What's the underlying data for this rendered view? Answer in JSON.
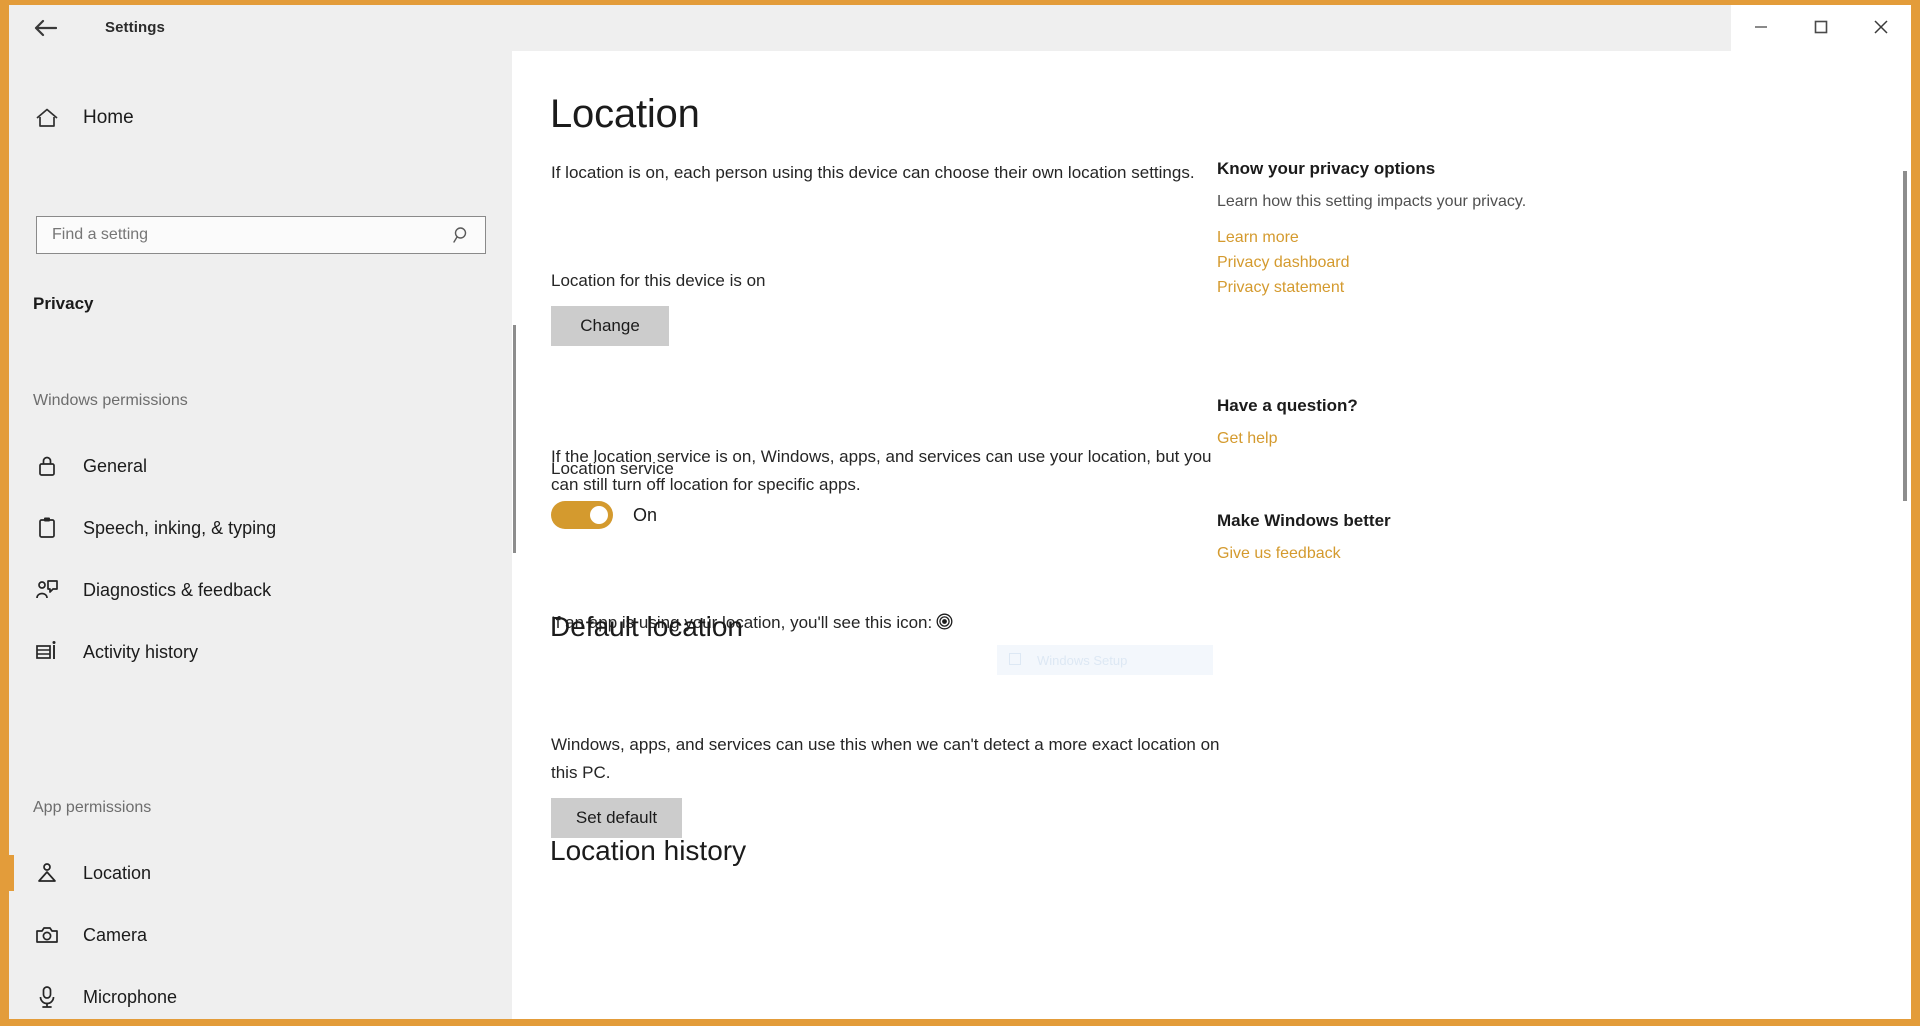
{
  "window": {
    "title": "Settings",
    "back_icon": "back-arrow-icon",
    "controls": {
      "minimize": "minimize-icon",
      "maximize": "maximize-icon",
      "close": "close-icon"
    }
  },
  "sidebar": {
    "home": {
      "label": "Home",
      "icon": "home-icon"
    },
    "search": {
      "placeholder": "Find a setting",
      "value": "",
      "icon": "search-icon"
    },
    "current_section": "Privacy",
    "groups": [
      {
        "header": "Windows permissions",
        "items": [
          {
            "label": "General",
            "icon": "lock-icon",
            "selected": false
          },
          {
            "label": "Speech, inking, & typing",
            "icon": "clipboard-icon",
            "selected": false
          },
          {
            "label": "Diagnostics & feedback",
            "icon": "feedback-person-icon",
            "selected": false
          },
          {
            "label": "Activity history",
            "icon": "activity-history-icon",
            "selected": false
          }
        ]
      },
      {
        "header": "App permissions",
        "items": [
          {
            "label": "Location",
            "icon": "location-pin-person-icon",
            "selected": true
          },
          {
            "label": "Camera",
            "icon": "camera-icon",
            "selected": false
          },
          {
            "label": "Microphone",
            "icon": "microphone-icon",
            "selected": false
          }
        ]
      }
    ]
  },
  "main": {
    "page_title": "Location",
    "intro_text": "If location is on, each person using this device can choose their own location settings.",
    "device_state_text": "Location for this device is on",
    "change_button": "Change",
    "service_description": "If the location service is on, Windows, apps, and services can use your location, but you can still turn off location for specific apps.",
    "location_service_label": "Location service",
    "location_service_state": "On",
    "location_service_on": true,
    "icon_note_text": "If an app is using your location, you'll see this icon:",
    "icon_note_icon": "location-active-icon",
    "default_location": {
      "heading": "Default location",
      "description": "Windows, apps, and services can use this when we can't detect a more exact location on this PC.",
      "button": "Set default"
    },
    "location_history": {
      "heading": "Location history"
    },
    "ghost_tooltip": {
      "text": "Windows Setup",
      "icon": "window-icon"
    }
  },
  "info_column": {
    "blocks": [
      {
        "title": "Know your privacy options",
        "description": "Learn how this setting impacts your privacy.",
        "links": [
          "Learn more",
          "Privacy dashboard",
          "Privacy statement"
        ]
      },
      {
        "title": "Have a question?",
        "description": "",
        "links": [
          "Get help"
        ]
      },
      {
        "title": "Make Windows better",
        "description": "",
        "links": [
          "Give us feedback"
        ]
      }
    ]
  },
  "colors": {
    "accent": "#d49a2e",
    "frame": "#e39c3a",
    "sidebar_bg": "#efefef",
    "button_bg": "#cccccc"
  }
}
